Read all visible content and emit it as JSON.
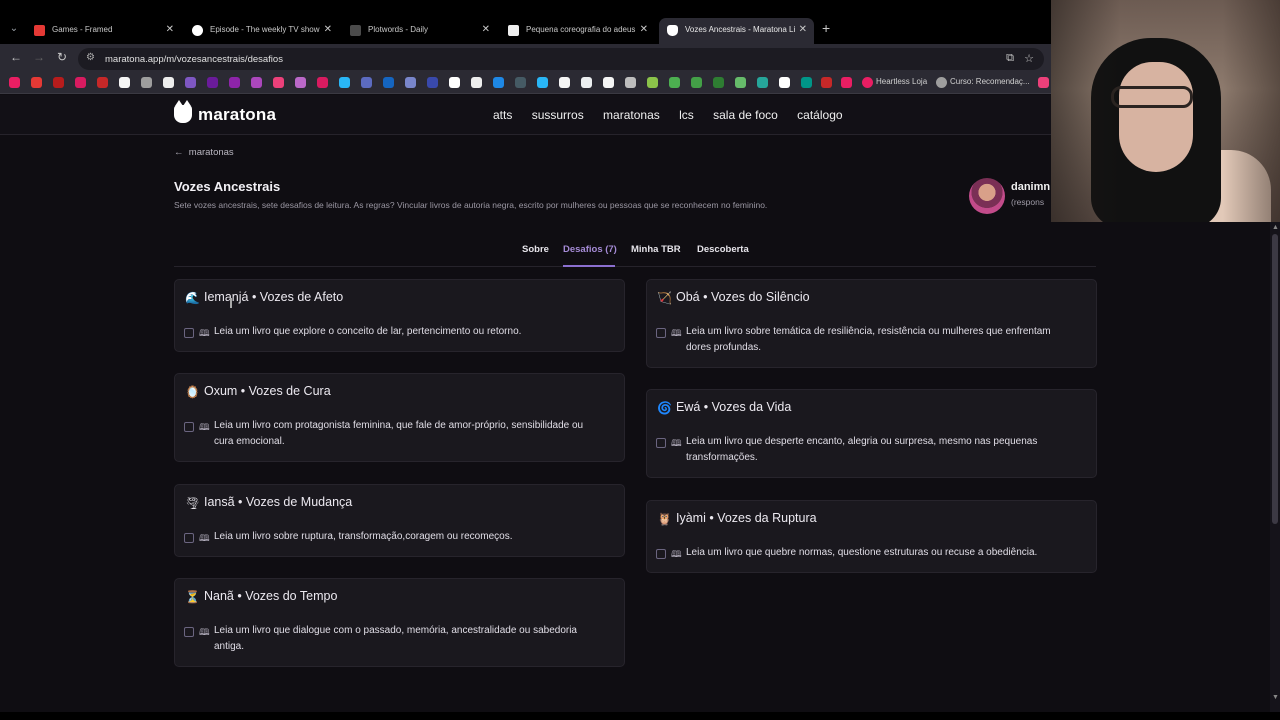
{
  "browser": {
    "tabs": [
      {
        "title": "Games - Framed",
        "color": "#e53935",
        "active": false
      },
      {
        "title": "Episode - The weekly TV show",
        "color": "#ffffff",
        "active": false
      },
      {
        "title": "Plotwords - Daily",
        "color": "#4b4b4b",
        "active": false
      },
      {
        "title": "Pequena coreografia do adeus",
        "color": "#eeeeee",
        "active": false
      },
      {
        "title": "Vozes Ancestrais - Maratona Li",
        "color": "#ffffff",
        "active": true
      }
    ],
    "url": "maratona.app/m/vozesancestrais/desafios",
    "bookmarks_text": [
      "Heartless Loja",
      "Curso: Recomendaç..."
    ]
  },
  "site": {
    "logo": "maratona",
    "nav": [
      "atts",
      "sussurros",
      "maratonas",
      "lcs",
      "sala de foco",
      "catálogo"
    ]
  },
  "page": {
    "back_label": "maratonas",
    "title": "Vozes Ancestrais",
    "description": "Sete vozes ancestrais, sete desafios de leitura. As regras? Vincular livros de autoria negra, escrito por mulheres ou pessoas que se reconhecem no feminino.",
    "owner_name": "danimn",
    "owner_role": "(respons",
    "tabs": [
      "Sobre",
      "Desafios (7)",
      "Minha TBR",
      "Descoberta"
    ],
    "active_tab": "Desafios (7)"
  },
  "challenges": [
    {
      "emoji": "🌊",
      "title": "Iemanjá • Vozes de Afeto",
      "text": [
        "Leia um livro que explore o conceito de lar, pertencimento ou retorno."
      ]
    },
    {
      "emoji": "🏹",
      "title": "Obá • Vozes do Silêncio",
      "text": [
        "Leia um livro sobre temática de resiliência, resistência ou mulheres que enfrentam",
        "dores profundas."
      ]
    },
    {
      "emoji": "🪞",
      "title": "Oxum • Vozes de Cura",
      "text": [
        "Leia um livro com protagonista feminina, que fale de amor-próprio, sensibilidade ou",
        "cura emocional."
      ]
    },
    {
      "emoji": "🌀",
      "title": "Ewá • Vozes da Vida",
      "text": [
        "Leia um livro que desperte encanto, alegria ou surpresa, mesmo nas pequenas",
        "transformações."
      ]
    },
    {
      "emoji": "🌪",
      "title": "Iansã • Vozes de Mudança",
      "text": [
        "Leia um livro sobre ruptura, transformação,coragem ou recomeços."
      ]
    },
    {
      "emoji": "🦉",
      "title": "Iyàmi • Vozes da Ruptura",
      "text": [
        "Leia um livro que quebre normas, questione estruturas ou recuse a obediência."
      ]
    },
    {
      "emoji": "⏳",
      "title": "Nanã • Vozes do Tempo",
      "text": [
        "Leia um livro que dialogue com o passado, memória, ancestralidade ou sabedoria",
        "antiga."
      ]
    }
  ]
}
